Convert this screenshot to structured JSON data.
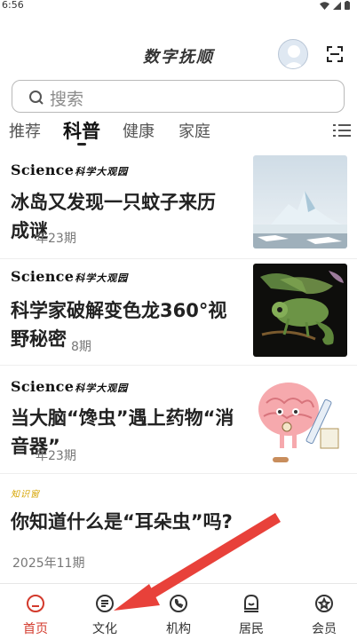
{
  "status_bar": {
    "time": "6:56"
  },
  "header": {
    "title": "数字抚顺",
    "avatar_icon": "avatar-icon",
    "scan_icon": "scan-icon"
  },
  "search": {
    "placeholder": "搜索"
  },
  "tabs": [
    {
      "label": "推荐",
      "active": false
    },
    {
      "label": "科普",
      "active": true
    },
    {
      "label": "健康",
      "active": false
    },
    {
      "label": "家庭",
      "active": false
    }
  ],
  "feed": {
    "articles": [
      {
        "source": "Science",
        "source_cn": "科学大观园",
        "title_line1": "冰岛又发现一只蚊子来历",
        "title_line2": "成谜",
        "meta": "年23期"
      },
      {
        "source": "Science",
        "source_cn": "科学大观园",
        "title_line1": "科学家破解变色龙360°视",
        "title_line2": "野秘密",
        "meta": "8期"
      },
      {
        "source": "Science",
        "source_cn": "科学大观园",
        "title_line1": "当大脑“馋虫”遇上药物“消",
        "title_line2": "音器”",
        "meta": "年23期"
      },
      {
        "source": "知识窗",
        "title_line1": "你知道什么是“耳朵虫”吗?",
        "meta": "2025年11期"
      }
    ]
  },
  "bottom_nav": [
    {
      "label": "首页",
      "icon": "home-icon",
      "active": true
    },
    {
      "label": "文化",
      "icon": "culture-icon",
      "active": false
    },
    {
      "label": "机构",
      "icon": "phone-icon",
      "active": false
    },
    {
      "label": "居民",
      "icon": "resident-icon",
      "active": false
    },
    {
      "label": "会员",
      "icon": "member-icon",
      "active": false
    }
  ],
  "colors": {
    "accent": "#d33a2c",
    "arrow": "#e8413a"
  }
}
